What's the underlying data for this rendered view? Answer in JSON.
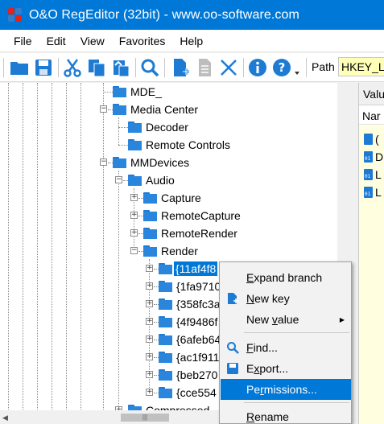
{
  "window": {
    "title": "O&O RegEditor (32bit) - www.oo-software.com"
  },
  "menu": [
    "File",
    "Edit",
    "View",
    "Favorites",
    "Help"
  ],
  "toolbar": {
    "path_label": "Path",
    "path_value": "HKEY_LOCAL"
  },
  "tree": {
    "nodes": [
      {
        "label": "MDE_"
      },
      {
        "label": "Media Center"
      },
      {
        "label": "Decoder"
      },
      {
        "label": "Remote Controls"
      },
      {
        "label": "MMDevices"
      },
      {
        "label": "Audio"
      },
      {
        "label": "Capture"
      },
      {
        "label": "RemoteCapture"
      },
      {
        "label": "RemoteRender"
      },
      {
        "label": "Render"
      },
      {
        "label": "{11af4f8"
      },
      {
        "label": "{1fa9710"
      },
      {
        "label": "{358fc3a"
      },
      {
        "label": "{4f9486f"
      },
      {
        "label": "{6afeb64"
      },
      {
        "label": "{ac1f911"
      },
      {
        "label": "{beb270"
      },
      {
        "label": "{cce554"
      },
      {
        "label": "Compressed_"
      }
    ],
    "hscroll_grip": "|||"
  },
  "right_pane": {
    "header": "Valu",
    "column": "Nar",
    "rows": [
      "(",
      "D",
      "L",
      "L"
    ]
  },
  "context_menu": {
    "items": [
      {
        "label": "Expand branch",
        "accel": "E"
      },
      {
        "label": "New key",
        "accel": "N"
      },
      {
        "label": "New value",
        "accel": "v"
      },
      {
        "label": "Find...",
        "accel": "F"
      },
      {
        "label": "Export...",
        "accel": "x"
      },
      {
        "label": "Permissions...",
        "accel": "r"
      },
      {
        "label": "Rename",
        "accel": "R"
      }
    ],
    "hovered": "Permissions..."
  },
  "colors": {
    "accent": "#0078d7",
    "folder": "#2a86dd",
    "path_bg": "#ffffb8",
    "list_bg": "#ffffe0"
  }
}
